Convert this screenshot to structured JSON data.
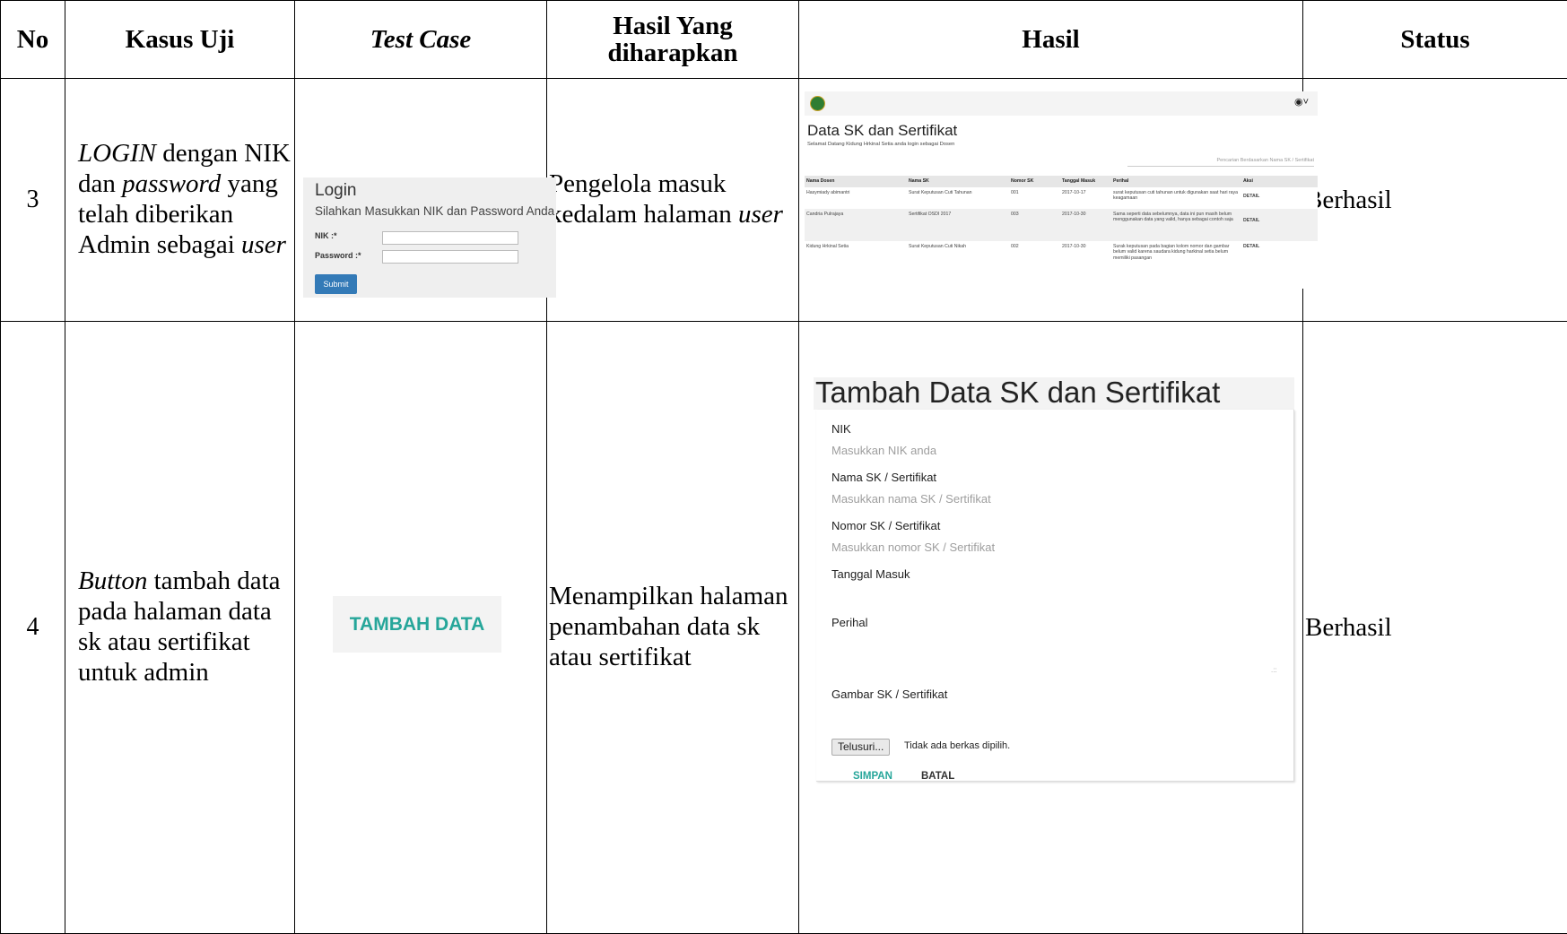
{
  "headers": {
    "no": "No",
    "kasus_uji": "Kasus Uji",
    "test_case": "Test Case",
    "hasil_yang": "Hasil Yang",
    "diharapkan": "diharapkan",
    "hasil": "Hasil",
    "status": "Status"
  },
  "row3": {
    "no": "3",
    "kasus_p1_italic": "LOGIN",
    "kasus_p2": " dengan NIK dan ",
    "kasus_p3_italic": "password",
    "kasus_p4": " yang telah diberikan Admin sebagai ",
    "kasus_p5_italic": "user",
    "expected_p1": "Pengelola masuk kedalam halaman ",
    "expected_p2_italic": "user",
    "status": "Berhasil",
    "login": {
      "title": "Login",
      "subtitle": "Silahkan Masukkan NIK dan Password Anda",
      "nik_label": "NIK :*",
      "password_label": "Password :*",
      "submit": "Submit"
    },
    "user_page": {
      "title": "Data SK dan Sertifikat",
      "welcome": "Selamat Datang Kidung Hrkinal Setia anda login sebagai Dosen",
      "search_placeholder": "Pencarian Berdasarkan Nama SK / Sertifikat",
      "account_icon": "user-circle-icon",
      "columns": [
        "Nama Dosen",
        "Nama SK",
        "Nomor SK",
        "Tanggal Masuk",
        "Perihal",
        "Aksi"
      ],
      "rows": [
        [
          "Hasymiady abimantri",
          "Surat Keputusan Cuti Tahunan",
          "001",
          "2017-10-17",
          "surat keputusan cuti tahunan untuk digunakan saat hari raya keagamaan",
          "DETAIL"
        ],
        [
          "Candria Pulrajaya",
          "Sertifikat OSDI 2017",
          "003",
          "2017-10-30",
          "Sama seperti data sebelumnya, data ini pun masih belum menggunakan data yang valid, hanya sebagai contoh saja",
          "DETAIL"
        ],
        [
          "Kidung Hrkinal Setia",
          "Surat Keputusan Cuti Nikah",
          "002",
          "2017-10-30",
          "Surak keputusan pada bagian kolom nomor dan gambar belum valid karena saudara kidung harkinal setia belum memiliki pasangan",
          "DETAIL"
        ]
      ]
    }
  },
  "row4": {
    "no": "4",
    "kasus_p1_italic": "Button",
    "kasus_p2": " tambah  data pada halaman data sk atau sertifikat untuk admin",
    "test_case_button": "TAMBAH DATA",
    "expected": "Menampilkan halaman penambahan data sk atau sertifikat",
    "status": "Berhasil",
    "form": {
      "title": "Tambah Data SK dan Sertifikat",
      "nik_label": "NIK",
      "nik_placeholder": "Masukkan NIK anda",
      "nama_label": "Nama SK / Sertifikat",
      "nama_placeholder": "Masukkan nama SK / Sertifikat",
      "nomor_label": "Nomor SK / Sertifikat",
      "nomor_placeholder": "Masukkan nomor SK / Sertifikat",
      "tanggal_label": "Tanggal Masuk",
      "perihal_label": "Perihal",
      "gambar_label": "Gambar SK / Sertifikat",
      "browse_button": "Telusuri...",
      "no_file": "Tidak ada berkas dipilih.",
      "simpan": "SIMPAN",
      "batal": "BATAL"
    }
  }
}
